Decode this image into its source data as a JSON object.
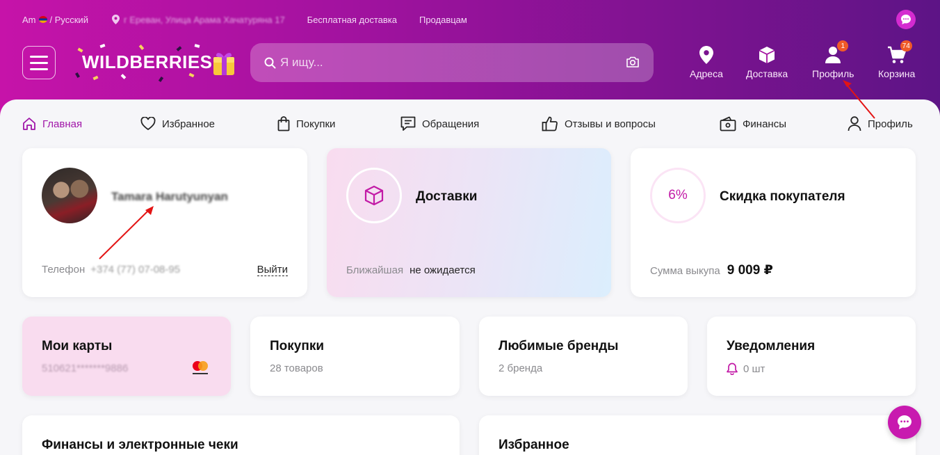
{
  "topbar": {
    "currency": "Am",
    "language": "/ Русский",
    "location": "г Ереван, Улица Арама Хачатуряна 17",
    "free_delivery": "Бесплатная доставка",
    "sellers": "Продавцам"
  },
  "header": {
    "logo_text": "WILDBERRIES",
    "search_placeholder": "Я ищу...",
    "nav": [
      {
        "label": "Адреса",
        "icon": "location-icon"
      },
      {
        "label": "Доставка",
        "icon": "box-icon"
      },
      {
        "label": "Профиль",
        "icon": "user-icon",
        "badge": "1"
      },
      {
        "label": "Корзина",
        "icon": "cart-icon",
        "badge": "74"
      }
    ]
  },
  "tabs": [
    {
      "label": "Главная",
      "icon": "home-icon",
      "active": true
    },
    {
      "label": "Избранное",
      "icon": "heart-icon"
    },
    {
      "label": "Покупки",
      "icon": "bag-icon"
    },
    {
      "label": "Обращения",
      "icon": "message-icon"
    },
    {
      "label": "Отзывы и вопросы",
      "icon": "thumbs-up-icon"
    },
    {
      "label": "Финансы",
      "icon": "wallet-icon"
    },
    {
      "label": "Профиль",
      "icon": "user-icon"
    }
  ],
  "profile_card": {
    "name": "Tamara Harutyunyan",
    "phone_label": "Телефон",
    "phone_value": "+374 (77) 07-08-95",
    "logout": "Выйти"
  },
  "delivery_card": {
    "title": "Доставки",
    "nearest_label": "Ближайшая",
    "nearest_value": "не ожидается"
  },
  "discount_card": {
    "percent": "6%",
    "title": "Скидка покупателя",
    "sum_label": "Сумма выкупа",
    "sum_value": "9 009 ₽"
  },
  "small_cards": [
    {
      "title": "Мои карты",
      "sub": "510621*******9886"
    },
    {
      "title": "Покупки",
      "sub": "28 товаров"
    },
    {
      "title": "Любимые бренды",
      "sub": "2 бренда"
    },
    {
      "title": "Уведомления",
      "sub": "0 шт"
    }
  ],
  "bottom_cards": [
    {
      "title": "Финансы и электронные чеки"
    },
    {
      "title": "Избранное"
    }
  ],
  "colors": {
    "accent": "#a016a8",
    "header_start": "#c613a9",
    "header_end": "#5d1486",
    "badge": "#f05a28"
  }
}
